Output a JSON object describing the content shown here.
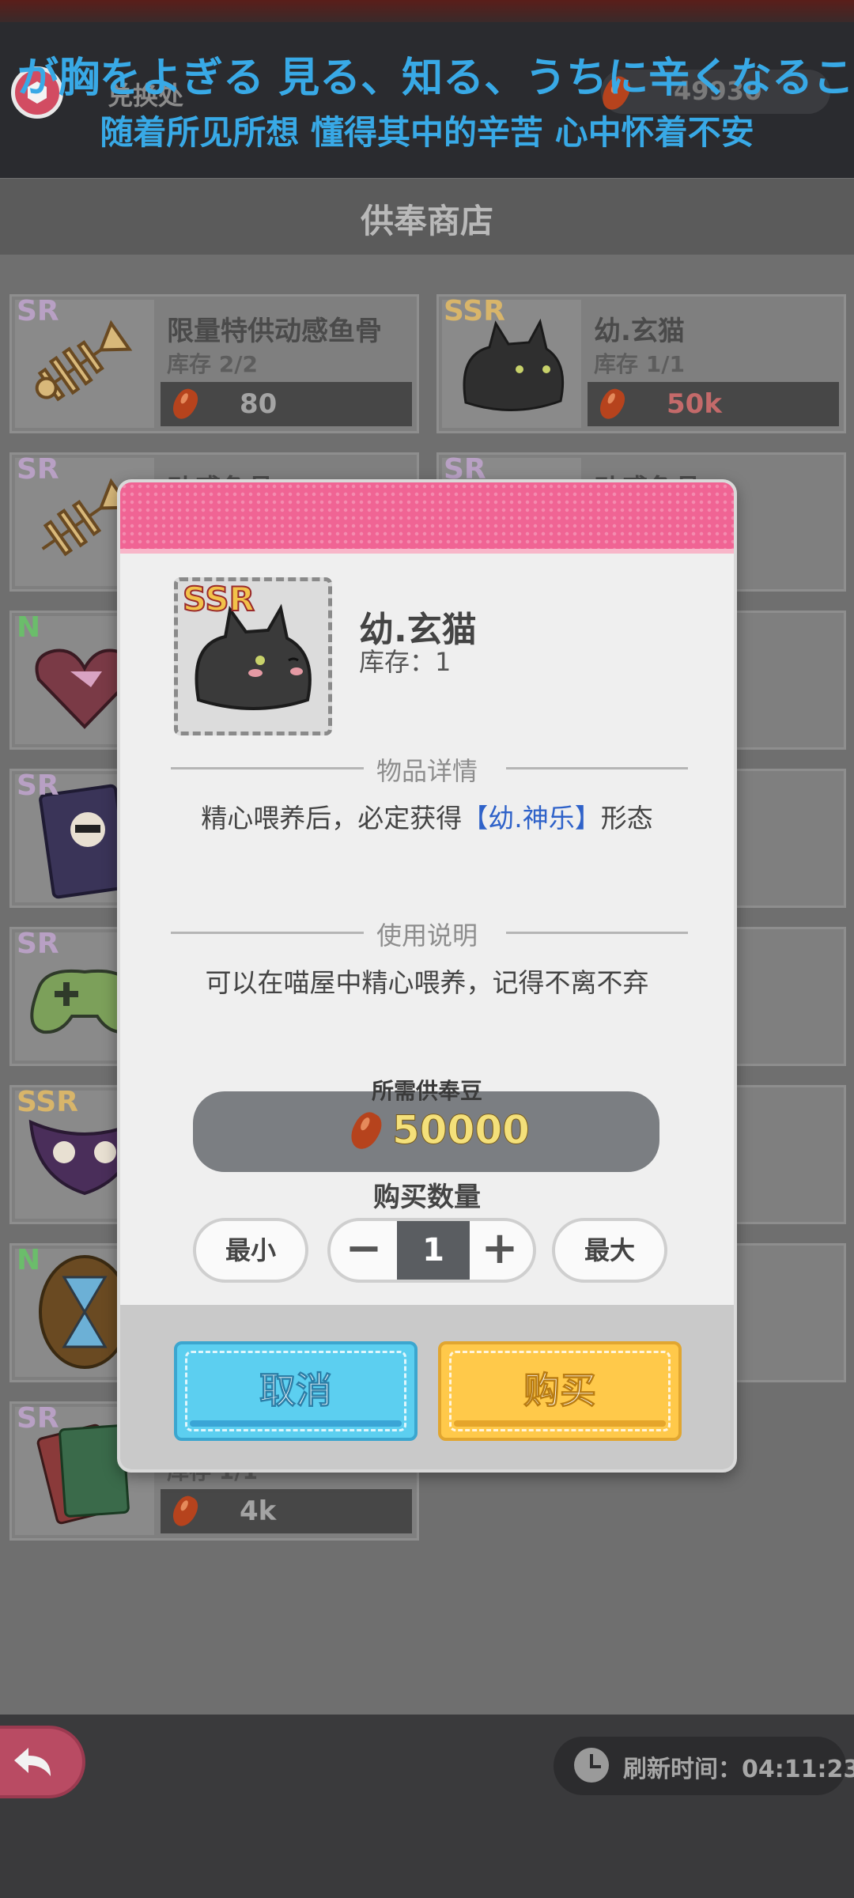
{
  "topbar": {
    "exchange_label": "兑换处",
    "currency_value": "49930",
    "lyric_jp": "が胸をよぎる 見る、知る、うちに辛くなるこ⸨",
    "lyric_cn": "随着所见所想 懂得其中的辛苦 心中怀着不安"
  },
  "shop": {
    "title": "供奉商店",
    "items": [
      {
        "rarity": "SR",
        "name": "限量特供动感鱼骨",
        "stock": "库存 2/2",
        "price": "80"
      },
      {
        "rarity": "SSR",
        "name": "幼.玄猫",
        "stock": "库存 1/1",
        "price": "50k"
      },
      {
        "rarity": "SR",
        "name": "动感鱼骨",
        "stock": "",
        "price": ""
      },
      {
        "rarity": "SR",
        "name": "动感鱼骨",
        "stock": "",
        "price": ""
      },
      {
        "rarity": "N",
        "name": "",
        "stock": "",
        "price": ""
      },
      {
        "rarity": "SR",
        "name": "",
        "stock": "",
        "price": ""
      },
      {
        "rarity": "SR",
        "name": "",
        "stock": "",
        "price": ""
      },
      {
        "rarity": "SSR",
        "name": "",
        "stock": "",
        "price": ""
      },
      {
        "rarity": "N",
        "name": "",
        "stock": "",
        "price": ""
      },
      {
        "rarity": "SR",
        "name": "",
        "stock": "库存 1/1",
        "price": "4k"
      }
    ]
  },
  "modal": {
    "item_rarity": "SSR",
    "item_name": "幼.玄猫",
    "item_stock": "库存：1",
    "details_title": "物品详情",
    "details_text_before": "精心喂养后，必定获得",
    "details_text_highlight": "【幼.神乐】",
    "details_text_after": "形态",
    "usage_title": "使用说明",
    "usage_text": "可以在喵屋中精心喂养，记得不离不弃",
    "cost_label": "所需供奉豆",
    "cost_value": "50000",
    "quantity_title": "购买数量",
    "min_label": "最小",
    "minus_label": "−",
    "quantity_value": "1",
    "plus_label": "+",
    "max_label": "最大",
    "cancel_label": "取消",
    "buy_label": "购买"
  },
  "bottom": {
    "refresh_text": "刷新时间：04:11:23"
  },
  "colors": {
    "accent_pink": "#f06494",
    "cancel_blue": "#5ccff0",
    "buy_yellow": "#ffc94a",
    "lyric_blue": "#38a9e6",
    "highlight_blue": "#2f62c9"
  },
  "icons": [
    "shield-badge-icon",
    "bean-icon",
    "clock-icon",
    "back-arrow-icon",
    "fishbone-icon",
    "black-cat-icon",
    "heart-gift-icon",
    "gamepad-icon",
    "owl-mask-icon",
    "hourglass-icon",
    "cards-icon"
  ]
}
